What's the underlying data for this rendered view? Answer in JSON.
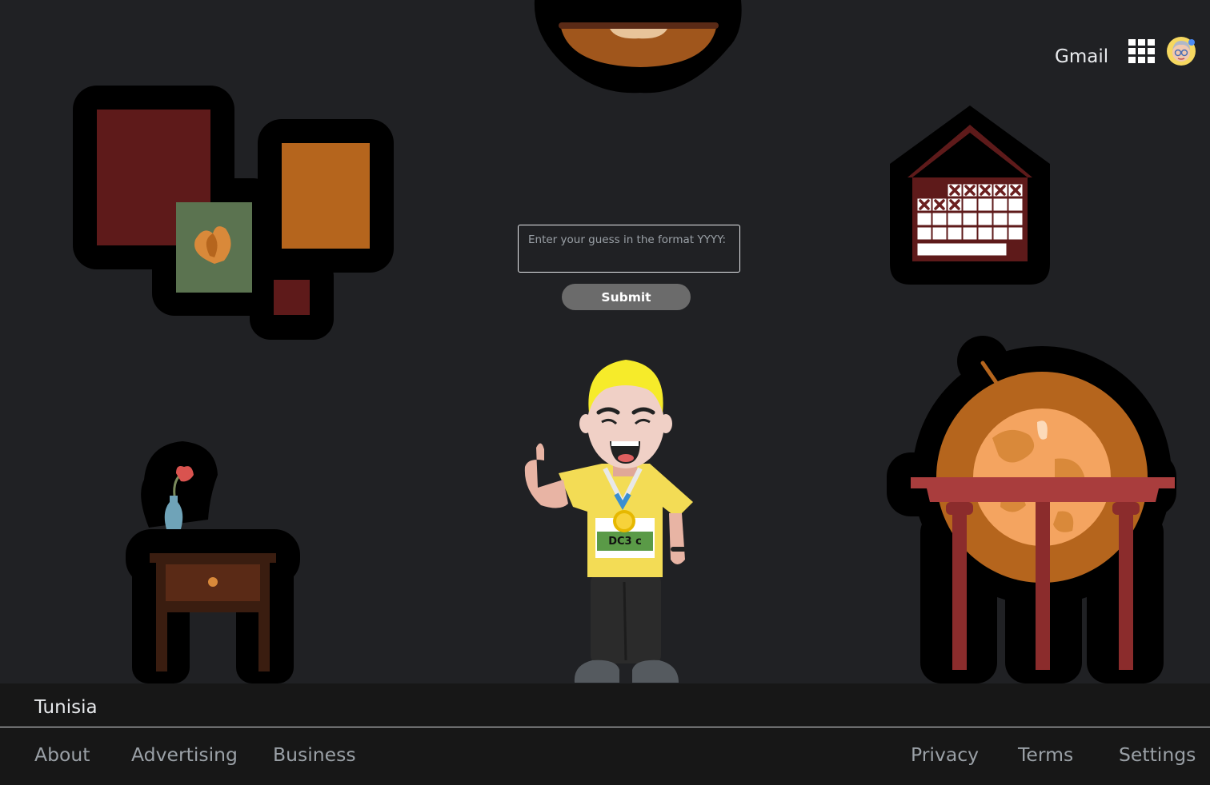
{
  "header": {
    "gmail_label": "Gmail"
  },
  "form": {
    "guess_placeholder": "Enter your guess in the format YYYY:",
    "submit_label": "Submit"
  },
  "character": {
    "bib_text": "DC3 c"
  },
  "footer": {
    "location": "Tunisia",
    "left_links": [
      "About",
      "Advertising",
      "Business"
    ],
    "right_links": [
      "Privacy",
      "Terms",
      "Settings"
    ]
  },
  "icons": [
    "apps-grid-icon",
    "user-avatar-icon"
  ],
  "colors": {
    "background": "#202124",
    "footer_background": "#171717",
    "footer_text": "#9aa0a6",
    "submit_button": "#6b6b6b",
    "maroon": "#5e1a1a",
    "orange": "#b5651d",
    "shirt_yellow": "#f3dc55"
  }
}
